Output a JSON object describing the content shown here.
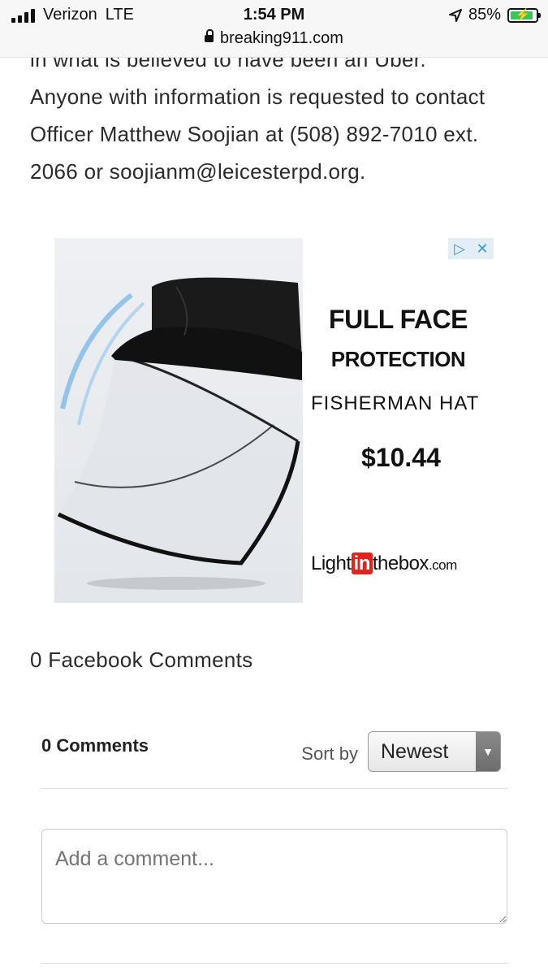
{
  "status_bar": {
    "carrier": "Verizon",
    "network": "LTE",
    "time": "1:54 PM",
    "battery": "85%",
    "url": "breaking911.com",
    "icons": [
      "signal-icon",
      "location-arrow-icon",
      "battery-charging-icon",
      "lock-icon"
    ]
  },
  "article": {
    "partial_line": "in what is believed to have been an Uber.",
    "text": "Anyone with information is requested to contact Officer Matthew Soojian at (508) 892-7010 ext. 2066 or soojianm@leicesterpd.org."
  },
  "ad": {
    "line1": "FULL FACE",
    "line2": "PROTECTION",
    "line3": "FISHERMAN HAT",
    "price": "$10.44",
    "brand_light": "Light",
    "brand_in": "in",
    "brand_thebox": "thebox",
    "brand_com": ".com",
    "choices_icons": [
      "ad-choices-icon",
      "close-icon"
    ]
  },
  "facebook_comments": "0 Facebook Comments",
  "comments": {
    "count_label": "0 Comments",
    "sort_label": "Sort by",
    "sort_value": "Newest",
    "placeholder": "Add a comment..."
  },
  "colors": {
    "battery_green": "#35c759",
    "brand_red": "#e0261c",
    "adchoices_blue": "#3a9ad9"
  }
}
